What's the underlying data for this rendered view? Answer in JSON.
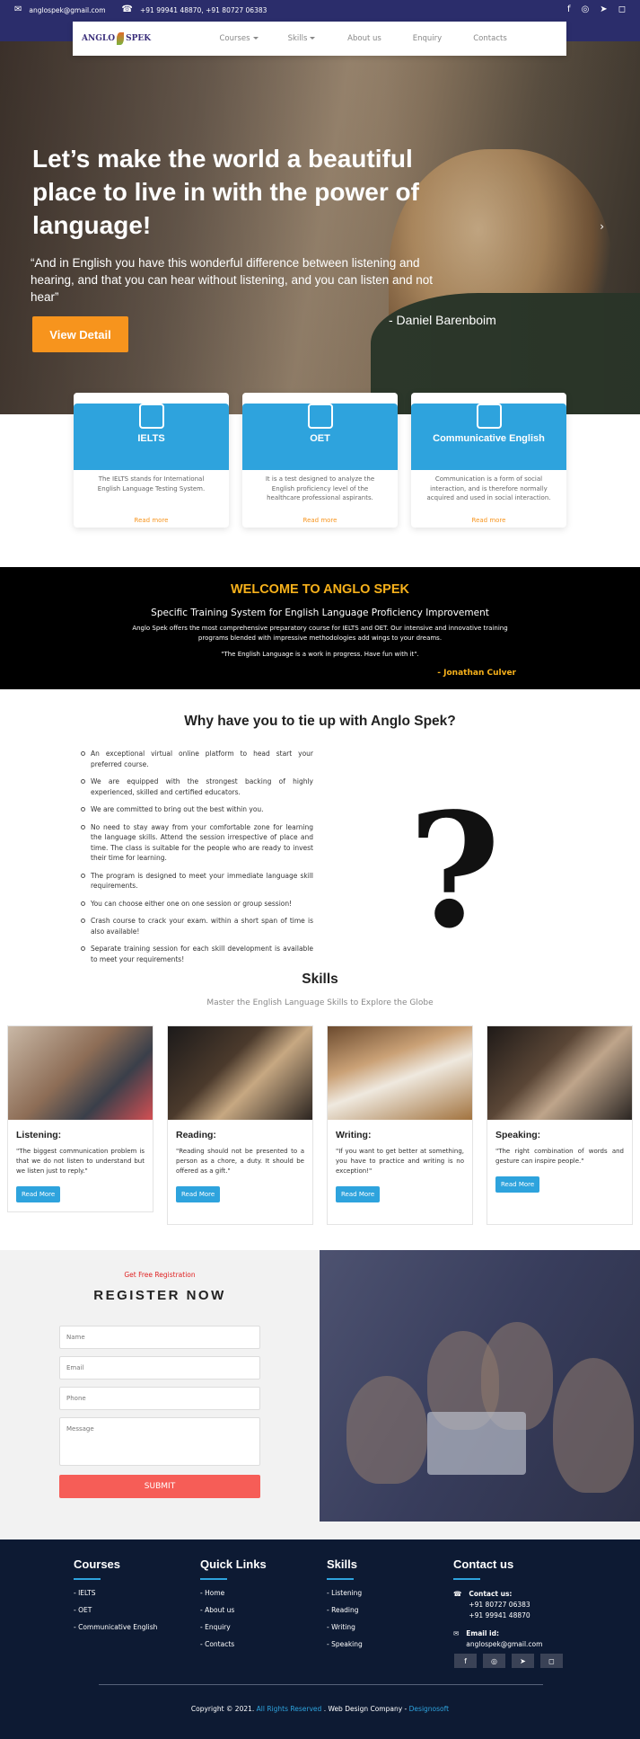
{
  "topbar": {
    "email": "anglospek@gmail.com",
    "phone": "+91 99941 48870, +91 80727 06383",
    "icons": [
      "envelope-icon",
      "phone-icon",
      "facebook-icon",
      "whatsapp-icon",
      "telegram-icon",
      "instagram-icon"
    ]
  },
  "nav": {
    "logo_left": "ANGLO",
    "logo_right": "SPEK",
    "items": [
      "Courses",
      "Skills",
      "About us",
      "Enquiry",
      "Contacts"
    ]
  },
  "hero": {
    "headline": "Let’s make the world a beautiful place to live in with the power of language!",
    "quote": "“And in English you have this wonderful difference between listening and hearing, and that you can hear without listening, and you can listen and not hear”",
    "author": "-  Daniel Barenboim",
    "button": "View Detail"
  },
  "courses": [
    {
      "title": "IELTS",
      "desc": "The IELTS stands for International English Language Testing System.",
      "link": "Read more"
    },
    {
      "title": "OET",
      "desc": "It is a test designed to analyze the English proficiency level of the healthcare professional aspirants.",
      "link": "Read more"
    },
    {
      "title": "Communicative English",
      "desc": "Communication is a form of social interaction, and is therefore normally acquired and used in social interaction.",
      "link": "Read more"
    }
  ],
  "welcome": {
    "title": "WELCOME TO ANGLO SPEK",
    "subtitle": "Specific Training System for English Language Proficiency Improvement",
    "text": "Anglo Spek offers the most comprehensive preparatory course for IELTS and OET. Our intensive and innovative training programs blended with impressive methodologies add wings to your dreams.",
    "quote": "\"The English Language is a work in progress. Have fun with it\".",
    "author": "- Jonathan Culver"
  },
  "why": {
    "title": "Why have you to tie up with Anglo Spek?",
    "points": [
      "An exceptional virtual online platform to head start your preferred course.",
      "We are equipped with the strongest backing of highly experienced, skilled and certified educators.",
      "We are committed to bring out the best within you.",
      "No need to stay away from your comfortable zone for learning the language skills. Attend the session irrespective of place and time. The class is suitable for the people who are ready to invest their time for learning.",
      "The program is designed to meet your immediate language skill requirements.",
      "You can choose either one on one session or group session!",
      "Crash course to crack your exam. within a short span of time is also available!",
      "Separate training session for each skill development is available to meet your requirements!"
    ],
    "graphic": "?"
  },
  "skills": {
    "title": "Skills",
    "subtitle": "Master the English Language Skills to Explore the Globe",
    "items": [
      {
        "title": "Listening:",
        "text": "\"The biggest communication problem is that we do not listen to understand but we listen just to reply.\"",
        "button": "Read More"
      },
      {
        "title": "Reading:",
        "text": "\"Reading should not be presented to a person as a chore, a duty. It should be offered as a gift.\"",
        "button": "Read More"
      },
      {
        "title": "Writing:",
        "text": "\"If you want to get better at something, you have to practice and writing is no exception!\"",
        "button": "Read More"
      },
      {
        "title": "Speaking:",
        "text": "\"The right combination of words and gesture can inspire people.\"",
        "button": "Read More"
      }
    ]
  },
  "register": {
    "tag": "Get Free Registration",
    "title": "REGISTER NOW",
    "name_placeholder": "Name",
    "email_placeholder": "Email",
    "phone_placeholder": "Phone",
    "message_placeholder": "Message",
    "submit": "SUBMIT"
  },
  "footer": {
    "courses_title": "Courses",
    "courses": [
      "- IELTS",
      "- OET",
      "- Communicative English"
    ],
    "links_title": "Quick Links",
    "links": [
      "- Home",
      "- About us",
      "- Enquiry",
      "- Contacts"
    ],
    "skills_title": "Skills",
    "skills": [
      "- Listening",
      "- Reading",
      "- Writing",
      "- Speaking"
    ],
    "contact_title": "Contact us",
    "contact_label": "Contact us:",
    "phone1": "+91 80727 06383",
    "phone2": "+91 99941 48870",
    "email_label": "Email id:",
    "email": "anglospek@gmail.com",
    "copy_prefix": "Copyright © 2021.",
    "copy_rights": "All Rights Reserved",
    "copy_middle": ". Web Design Company -",
    "copy_company": "Designosoft"
  }
}
